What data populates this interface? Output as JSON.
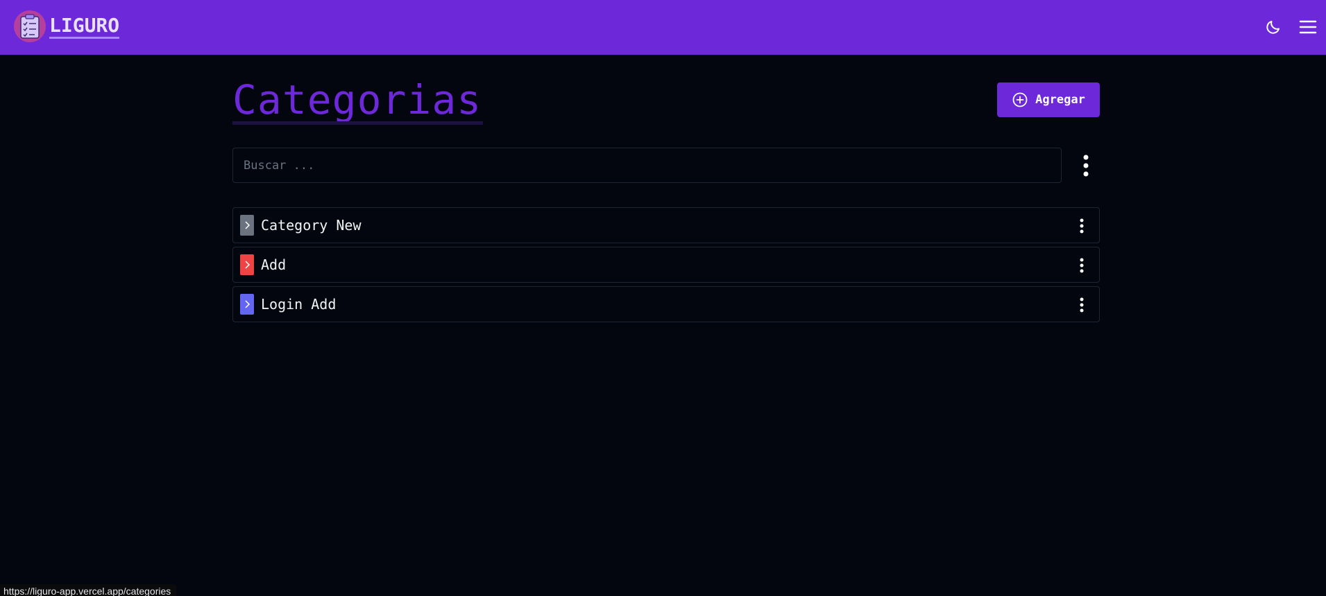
{
  "header": {
    "brand_name": "LIGURO",
    "theme_toggle_icon": "moon-icon",
    "menu_icon": "hamburger-icon",
    "logo_icon": "clipboard-checklist-icon"
  },
  "main": {
    "title": "Categorias",
    "add_button_label": "Agregar",
    "search": {
      "placeholder": "Buscar ...",
      "value": ""
    },
    "categories": [
      {
        "name": "Category New",
        "color": "#6b7280"
      },
      {
        "name": "Add",
        "color": "#ef4444"
      },
      {
        "name": "Login Add",
        "color": "#6366f1"
      }
    ]
  },
  "status_bar": {
    "url": "https://liguro-app.vercel.app/categories"
  },
  "colors": {
    "primary": "#6d28d9",
    "background": "#03060f",
    "border": "#1f2533"
  }
}
